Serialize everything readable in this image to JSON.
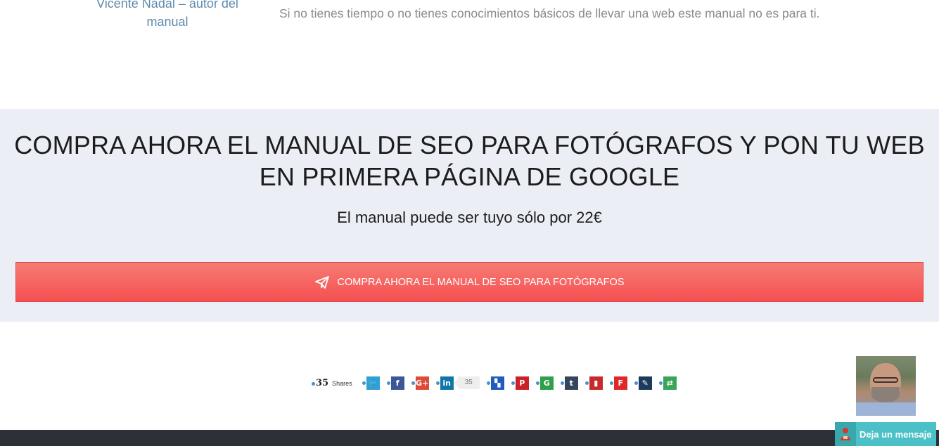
{
  "top": {
    "author_caption": "Vicente Nadal – autor del manual",
    "warning_text": "Si no tienes tiempo o no tienes conocimientos básicos de llevar una web este manual no es para ti."
  },
  "cta": {
    "title": "COMPRA AHORA EL MANUAL DE SEO PARA FOTÓGRAFOS Y PON TU WEB EN PRIMERA PÁGINA DE GOOGLE",
    "subtitle": "El manual puede ser tuyo sólo por 22€",
    "button_label": "COMPRA AHORA EL MANUAL DE SEO PARA FOTÓGRAFOS",
    "button_icon": "paper-plane-icon"
  },
  "share": {
    "total": "35",
    "total_label": "Shares",
    "linkedin_count": "35",
    "buttons": [
      {
        "network": "twitter",
        "icon": "twitter-icon",
        "glyph": "🐦",
        "color": "#2f9fd8"
      },
      {
        "network": "facebook",
        "icon": "facebook-icon",
        "glyph": "f",
        "color": "#3a5897"
      },
      {
        "network": "google-plus",
        "icon": "google-plus-icon",
        "glyph": "G+",
        "color": "#dd4b39"
      },
      {
        "network": "linkedin",
        "icon": "linkedin-icon",
        "glyph": "in",
        "color": "#0e76a8"
      },
      {
        "network": "delicious",
        "icon": "delicious-icon",
        "glyph": "▚",
        "color": "#205cc0"
      },
      {
        "network": "pinterest",
        "icon": "pinterest-icon",
        "glyph": "P",
        "color": "#cb2027"
      },
      {
        "network": "google",
        "icon": "google-icon",
        "glyph": "G",
        "color": "#2f9f4a"
      },
      {
        "network": "tumblr",
        "icon": "tumblr-icon",
        "glyph": "t",
        "color": "#35465c"
      },
      {
        "network": "bookmark",
        "icon": "bookmark-icon",
        "glyph": "▮",
        "color": "#c72a2a"
      },
      {
        "network": "flipboard",
        "icon": "flipboard-icon",
        "glyph": "F",
        "color": "#e12828"
      },
      {
        "network": "evernote",
        "icon": "evernote-icon",
        "glyph": "✎",
        "color": "#1f3b5c"
      },
      {
        "network": "more",
        "icon": "more-share-icon",
        "glyph": "⇄",
        "color": "#3aa457"
      }
    ]
  },
  "chat": {
    "label": "Deja un mensaje",
    "icon": "chat-person-icon",
    "accent": "#4bc1c7"
  },
  "colors": {
    "band_bg": "#ebeef5",
    "button_top": "#f67b74",
    "button_bottom": "#f55050",
    "footer": "#2c3037",
    "link": "#5d8cb0"
  }
}
